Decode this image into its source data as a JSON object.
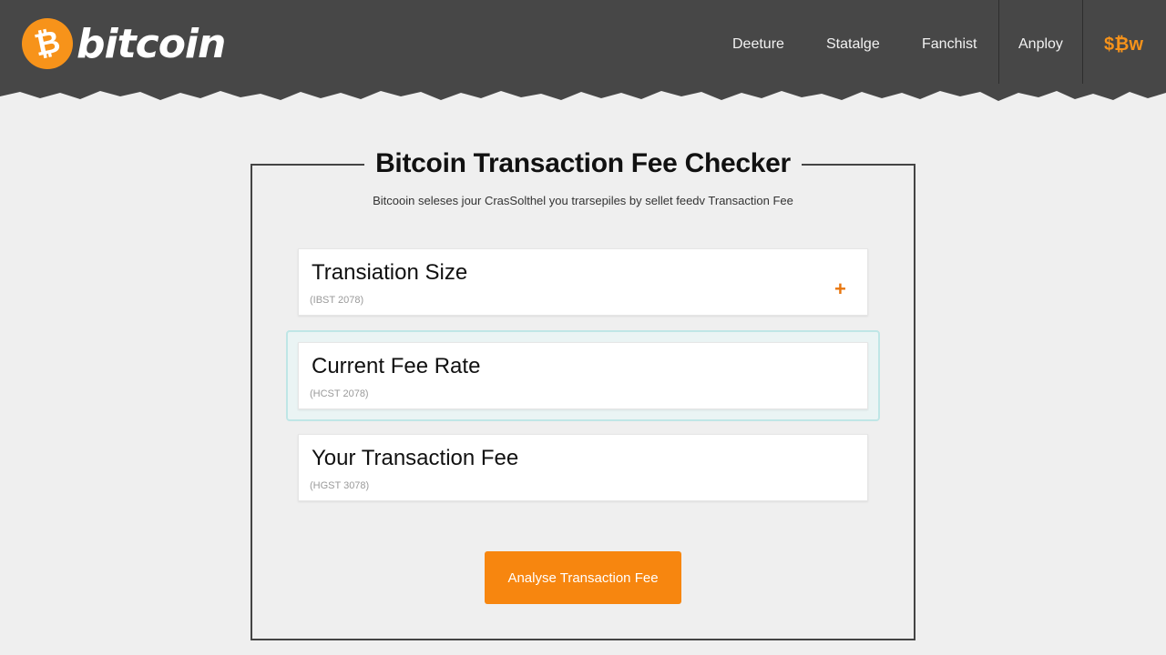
{
  "brand": {
    "symbol": "₿",
    "name": "bitcoin"
  },
  "nav": {
    "items": [
      "Deeture",
      "Statalge",
      "Fanchist",
      "Anploy"
    ],
    "btc_label": "$₿w"
  },
  "card": {
    "title": "Bitcoin Transaction Fee Checker",
    "subtitle": "Bitcooin seleses jour CrasSolthel you trarsepiles by sellet feedv Transaction Fee"
  },
  "fields": [
    {
      "label": "Transiation Size",
      "hint": "(IBST 2078)"
    },
    {
      "label": "Current Fee Rate",
      "hint": "(HCST 2078)"
    },
    {
      "label": "Your Transaction Fee",
      "hint": "(HGST 3078)"
    }
  ],
  "icons": {
    "add": "plus-icon",
    "logo": "bitcoin-logo-icon"
  },
  "colors": {
    "accent": "#f7931a",
    "button": "#f7860f",
    "header": "#474747",
    "focus": "#bfe6e6"
  },
  "action": {
    "label": "Analyse Transaction Fee"
  }
}
